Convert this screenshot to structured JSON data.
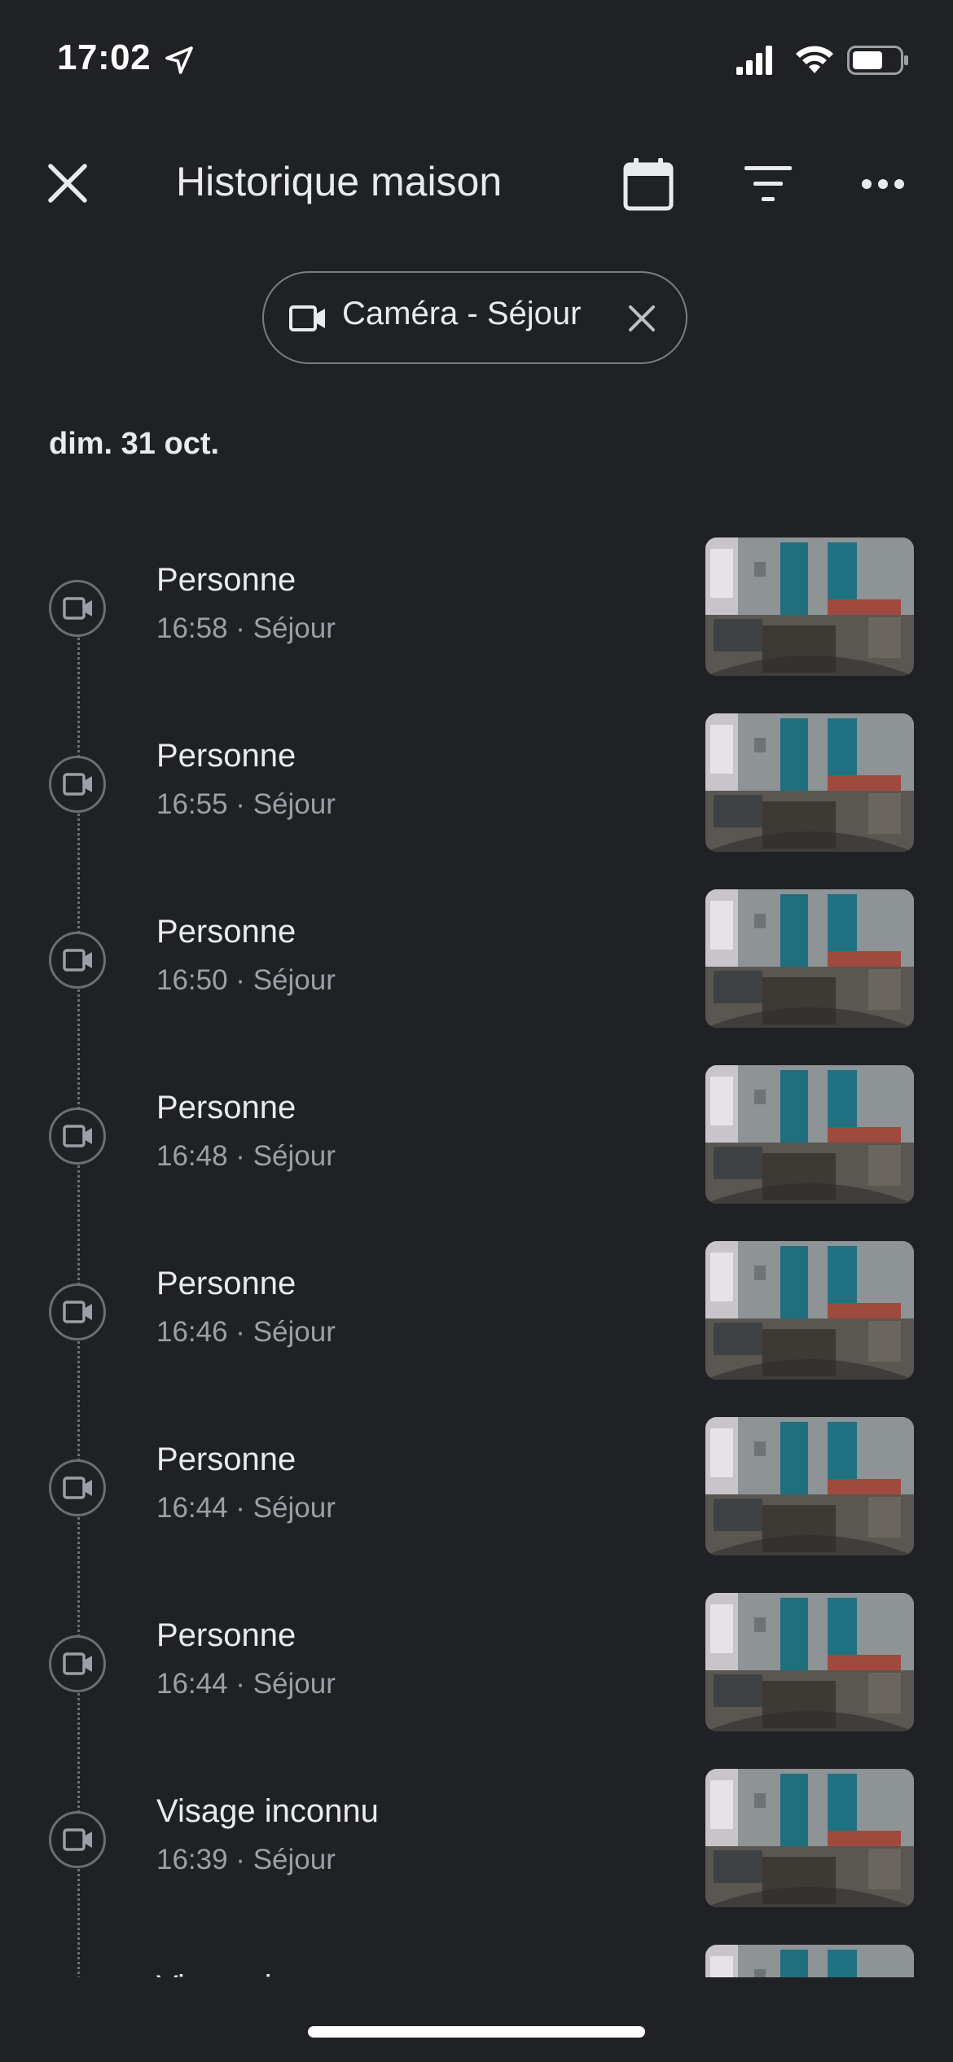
{
  "status_bar": {
    "time": "17:02"
  },
  "app_bar": {
    "title": "Historique maison"
  },
  "filter_chip": {
    "label": "Caméra - Séjour"
  },
  "date_header": "dim. 31 oct.",
  "events": [
    {
      "title": "Personne",
      "subtitle": "16:58 · Séjour"
    },
    {
      "title": "Personne",
      "subtitle": "16:55 · Séjour"
    },
    {
      "title": "Personne",
      "subtitle": "16:50 · Séjour"
    },
    {
      "title": "Personne",
      "subtitle": "16:48 · Séjour"
    },
    {
      "title": "Personne",
      "subtitle": "16:46 · Séjour"
    },
    {
      "title": "Personne",
      "subtitle": "16:44 · Séjour"
    },
    {
      "title": "Personne",
      "subtitle": "16:44 · Séjour"
    },
    {
      "title": "Visage inconnu",
      "subtitle": "16:39 · Séjour"
    },
    {
      "title": "Visage inconnu",
      "subtitle": ""
    }
  ],
  "icons": {
    "close": "close-icon",
    "calendar": "calendar-icon",
    "filter": "filter-icon",
    "more": "more-horizontal-icon",
    "camera": "video-camera-icon"
  },
  "colors": {
    "background": "#202124",
    "text_primary": "#e8eaed",
    "text_secondary": "#9aa0a6",
    "outline": "#6b6e73"
  }
}
